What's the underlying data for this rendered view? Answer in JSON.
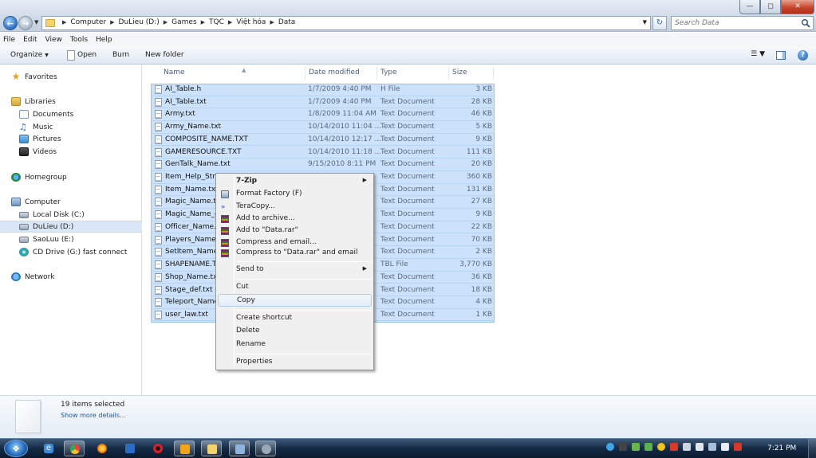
{
  "address": {
    "crumbs": [
      "Computer",
      "DuLieu (D:)",
      "Games",
      "TQC",
      "Việt hóa",
      "Data"
    ]
  },
  "search": {
    "placeholder": "Search Data"
  },
  "menu": [
    "File",
    "Edit",
    "View",
    "Tools",
    "Help"
  ],
  "toolbar": {
    "organize": "Organize",
    "open": "Open",
    "burn": "Burn",
    "new_folder": "New folder"
  },
  "nav": {
    "favorites": "Favorites",
    "libraries": "Libraries",
    "documents": "Documents",
    "music": "Music",
    "pictures": "Pictures",
    "videos": "Videos",
    "homegroup": "Homegroup",
    "computer": "Computer",
    "local_disk": "Local Disk (C:)",
    "dulieu": "DuLieu (D:)",
    "saoluu": "SaoLuu (E:)",
    "cd_drive": "CD Drive (G:) fast connect",
    "network": "Network"
  },
  "columns": {
    "name": "Name",
    "date": "Date modified",
    "type": "Type",
    "size": "Size"
  },
  "files": [
    {
      "name": "AI_Table.h",
      "date": "1/7/2009 4:40 PM",
      "type": "H File",
      "size": "3 KB"
    },
    {
      "name": "AI_Table.txt",
      "date": "1/7/2009 4:40 PM",
      "type": "Text Document",
      "size": "28 KB"
    },
    {
      "name": "Army.txt",
      "date": "1/8/2009 11:04 AM",
      "type": "Text Document",
      "size": "46 KB"
    },
    {
      "name": "Army_Name.txt",
      "date": "10/14/2010 11:04 ...",
      "type": "Text Document",
      "size": "5 KB"
    },
    {
      "name": "COMPOSITE_NAME.TXT",
      "date": "10/14/2010 12:17 ...",
      "type": "Text Document",
      "size": "9 KB"
    },
    {
      "name": "GAMERESOURCE.TXT",
      "date": "10/14/2010 11:18 ...",
      "type": "Text Document",
      "size": "111 KB"
    },
    {
      "name": "GenTalk_Name.txt",
      "date": "9/15/2010 8:11 PM",
      "type": "Text Document",
      "size": "20 KB"
    },
    {
      "name": "Item_Help_Strin",
      "date": "",
      "type": "Text Document",
      "size": "360 KB"
    },
    {
      "name": "Item_Name.txt",
      "date": "",
      "type": "Text Document",
      "size": "131 KB"
    },
    {
      "name": "Magic_Name.tx",
      "date": "",
      "type": "Text Document",
      "size": "27 KB"
    },
    {
      "name": "Magic_Name_e",
      "date": "",
      "type": "Text Document",
      "size": "9 KB"
    },
    {
      "name": "Officer_Name.tx",
      "date": "",
      "type": "Text Document",
      "size": "22 KB"
    },
    {
      "name": "Players_Name.t",
      "date": "",
      "type": "Text Document",
      "size": "70 KB"
    },
    {
      "name": "SetItem_Name.t",
      "date": "",
      "type": "Text Document",
      "size": "2 KB"
    },
    {
      "name": "SHAPENAME.TE",
      "date": "",
      "type": "TBL File",
      "size": "3,770 KB"
    },
    {
      "name": "Shop_Name.txt",
      "date": "",
      "type": "Text Document",
      "size": "36 KB"
    },
    {
      "name": "Stage_def.txt",
      "date": "",
      "type": "Text Document",
      "size": "18 KB"
    },
    {
      "name": "Teleport_Name.",
      "date": "",
      "type": "Text Document",
      "size": "4 KB"
    },
    {
      "name": "user_law.txt",
      "date": "",
      "type": "Text Document",
      "size": "1 KB"
    }
  ],
  "context_menu": {
    "sevenzip": "7-Zip",
    "format_factory": "Format Factory (F)",
    "teracopy": "TeraCopy...",
    "add_archive": "Add to archive...",
    "add_rar": "Add to \"Data.rar\"",
    "compress_email": "Compress and email...",
    "compress_rar_email": "Compress to \"Data.rar\" and email",
    "send_to": "Send to",
    "cut": "Cut",
    "copy": "Copy",
    "create_shortcut": "Create shortcut",
    "delete": "Delete",
    "rename": "Rename",
    "properties": "Properties"
  },
  "details": {
    "count": "19 items selected",
    "more": "Show more details..."
  },
  "clock": "7:21 PM"
}
